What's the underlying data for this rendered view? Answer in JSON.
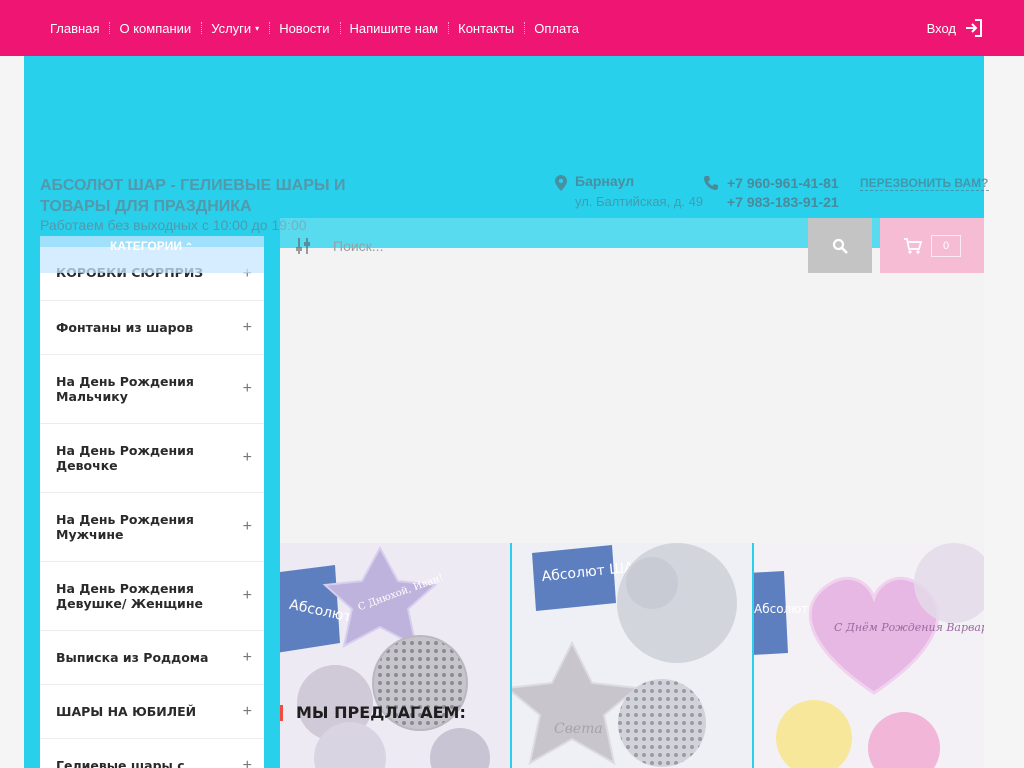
{
  "nav": {
    "items": [
      {
        "label": "Главная"
      },
      {
        "label": "О компании"
      },
      {
        "label": "Услуги",
        "caret": "▾"
      },
      {
        "label": "Новости"
      },
      {
        "label": "Напишите нам"
      },
      {
        "label": "Контакты"
      },
      {
        "label": "Оплата"
      }
    ],
    "login_label": "Вход"
  },
  "header": {
    "brand": "АБСОЛЮТ ШАР - ГЕЛИЕВЫЕ ШАРЫ И ТОВАРЫ ДЛЯ ПРАЗДНИКА",
    "hours": "Работаем без выходных с 10:00 до 19:00",
    "city": "Барнаул",
    "address": "ул. Балтийская, д. 49",
    "phones": [
      "+7 960-961-41-81",
      "+7 983-183-91-21"
    ],
    "callback": "ПЕРЕЗВОНИТЬ ВАМ?"
  },
  "search": {
    "placeholder": "Поиск..."
  },
  "cart": {
    "count": "0"
  },
  "categories": {
    "header": "КАТЕГОРИИ",
    "items": [
      "КОРОБКИ СЮРПРИЗ",
      "Фонтаны из шаров",
      "На День Рождения Мальчику",
      "На День Рождения Девочке",
      "На День Рождения Мужчине",
      "На День Рождения Девушке/ Женщине",
      "Выписка из Роддома",
      "ШАРЫ НА ЮБИЛЕЙ",
      "Гелиевые шары с"
    ]
  },
  "products": [
    {
      "sign_text": "Абсолют ШАР",
      "balloon_text": "С Днюхой, Иван!"
    },
    {
      "sign_text": "Абсолют ШАР",
      "balloon_text": "Света"
    },
    {
      "sign_text": "Абсолют ШАР",
      "balloon_text": "С Днём Рождения Варвара!"
    }
  ],
  "section": {
    "title": "МЫ ПРЕДЛАГАЕМ:"
  },
  "colors": {
    "brand_pink": "#ee1672",
    "cyan": "#29d0eb",
    "accent_red": "#ee4e3a"
  }
}
